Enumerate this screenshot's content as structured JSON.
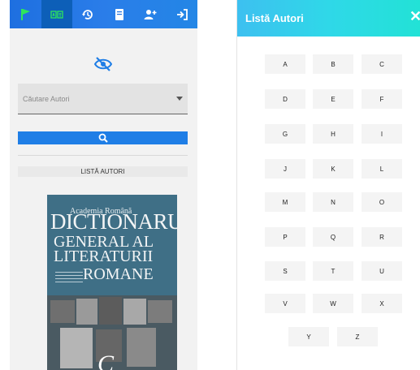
{
  "toolbar": {
    "items": [
      {
        "name": "flag-icon"
      },
      {
        "name": "translate-icon"
      },
      {
        "name": "history-icon"
      },
      {
        "name": "book-icon"
      },
      {
        "name": "add-user-icon"
      },
      {
        "name": "login-icon"
      }
    ],
    "active_index": 1,
    "colors": {
      "bar": "#1e6fe0",
      "active": "#0d5fb8",
      "flag": "#2ee65c"
    }
  },
  "visibility_icon": "visibility-off-icon",
  "search": {
    "placeholder": "Căutare Autori",
    "button_icon": "search-icon"
  },
  "list_label": "LISTĂ AUTORI",
  "book_cover": {
    "publisher": "Academia Română",
    "title_line1": "DICTIONARUL",
    "title_line2": "GENERAL AL",
    "title_line3": "LITERATURII",
    "title_line4": "ROMANE",
    "volume_letter": "C"
  },
  "dialog": {
    "title": "Listă Autori",
    "close_icon": "close-icon",
    "header_colors": [
      "#3dc0f0",
      "#22e2d6"
    ],
    "letters": [
      "A",
      "B",
      "C",
      "D",
      "E",
      "F",
      "G",
      "H",
      "I",
      "J",
      "K",
      "L",
      "M",
      "N",
      "O",
      "P",
      "Q",
      "R",
      "S",
      "T",
      "U",
      "V",
      "W",
      "X",
      "Y",
      "Z"
    ]
  }
}
